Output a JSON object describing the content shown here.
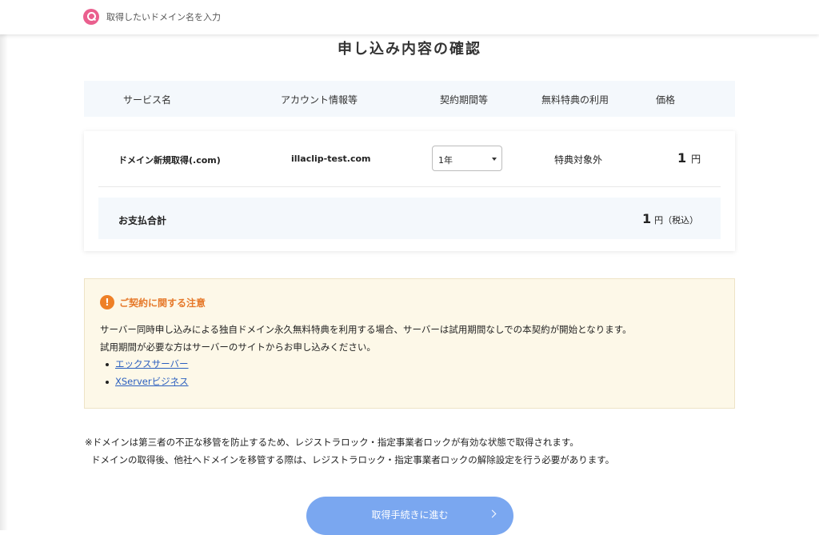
{
  "search": {
    "placeholder": "取得したいドメイン名を入力"
  },
  "page_title": "申し込み内容の確認",
  "table": {
    "headers": [
      "サービス名",
      "アカウント情報等",
      "契約期間等",
      "無料特典の利用",
      "価格"
    ],
    "row": {
      "service": "ドメイン新規取得(.com)",
      "account": "illaclip-test.com",
      "period": "1年",
      "benefit": "特典対象外",
      "price_value": "1",
      "price_unit": "円"
    },
    "total": {
      "label": "お支払合計",
      "value": "1",
      "unit": "円（税込）"
    }
  },
  "notice": {
    "title": "ご契約に関する注意",
    "lines": [
      "サーバー同時申し込みによる独自ドメイン永久無料特典を利用する場合、サーバーは試用期間なしでの本契約が開始となります。",
      "試用期間が必要な方はサーバーのサイトからお申し込みください。"
    ],
    "links": [
      "エックスサーバー",
      "XServerビジネス"
    ]
  },
  "footnotes": [
    "※ドメインは第三者の不正な移管を防止するため、レジストラロック・指定事業者ロックが有効な状態で取得されます。",
    "ドメインの取得後、他社へドメインを移管する際は、レジストラロック・指定事業者ロックの解除設定を行う必要があります。"
  ],
  "next_button": {
    "label": "取得手続きに進む"
  },
  "colors": {
    "accent_pink": "#ea5f8e",
    "notice_orange": "#e6792a",
    "link_blue": "#2b5fbf",
    "button_blue": "#7aa7f0",
    "table_band": "#f4f8fc",
    "notice_bg": "#fdf8e8"
  }
}
